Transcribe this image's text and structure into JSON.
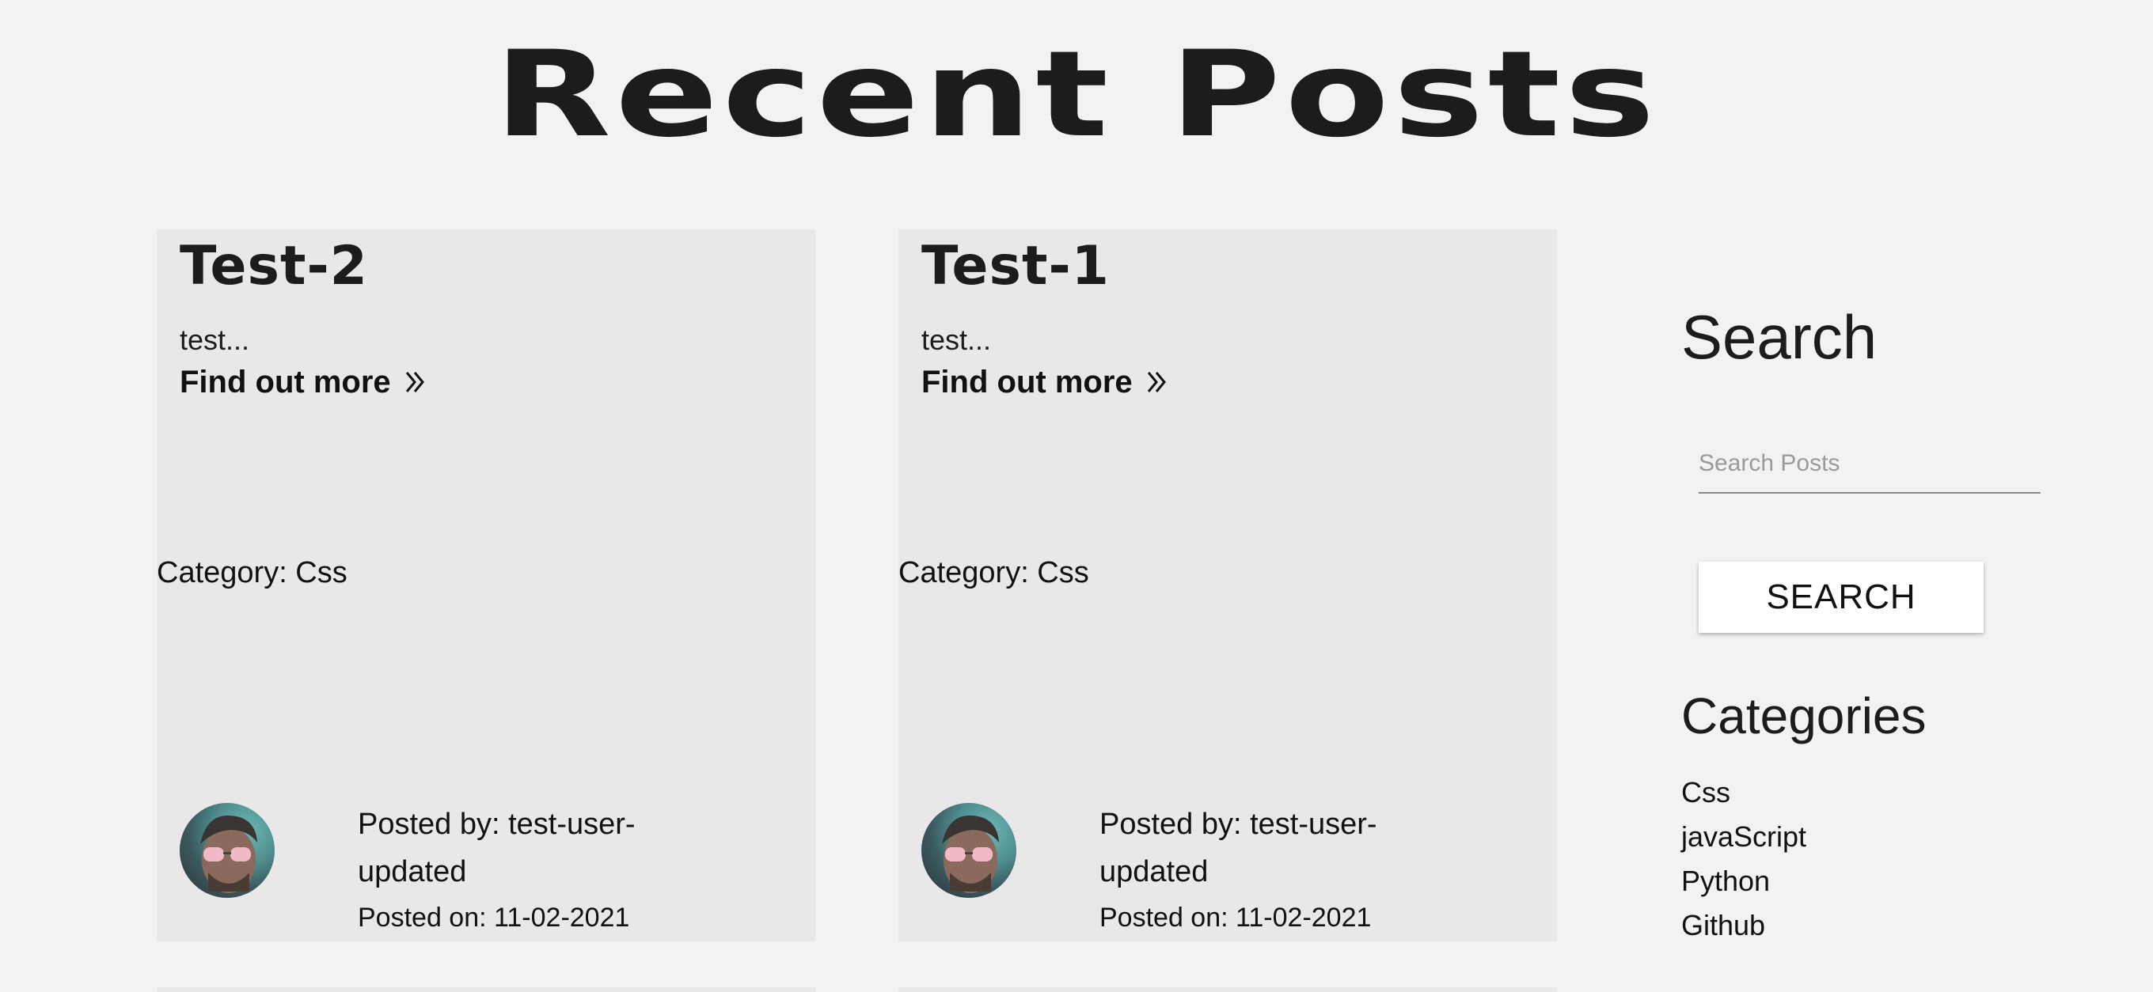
{
  "header": {
    "title": "Recent Posts"
  },
  "posts": [
    {
      "title": "Test-2",
      "excerpt": "test...",
      "link_label": "Find out more",
      "category": "Category: Css",
      "posted_by": "Posted by: test-user-updated",
      "posted_on": "Posted on: 11-02-2021"
    },
    {
      "title": "Test-1",
      "excerpt": "test...",
      "link_label": "Find out more",
      "category": "Category: Css",
      "posted_by": "Posted by: test-user-updated",
      "posted_on": "Posted on: 11-02-2021"
    }
  ],
  "sidebar": {
    "search_heading": "Search",
    "search_placeholder": "Search Posts",
    "search_button": "SEARCH",
    "categories_heading": "Categories",
    "categories": [
      "Css",
      "javaScript",
      "Python",
      "Github"
    ]
  },
  "icons": {
    "link_chevron": "double-chevron-right-icon",
    "avatar": "user-avatar"
  },
  "colors": {
    "background": "#f2f2f2",
    "card": "#e9e7e8",
    "text": "#1c1c1c"
  }
}
